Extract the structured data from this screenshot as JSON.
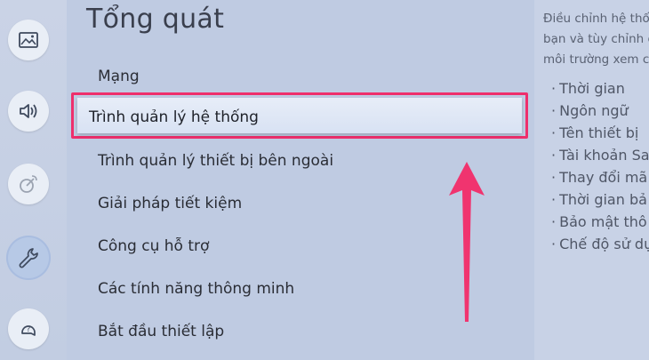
{
  "sidebar": {
    "items": [
      {
        "icon": "picture-icon"
      },
      {
        "icon": "sound-icon"
      },
      {
        "icon": "broadcast-icon"
      },
      {
        "icon": "wrench-icon"
      },
      {
        "icon": "support-icon"
      }
    ]
  },
  "menu": {
    "title": "Tổng quát",
    "items": [
      "Mạng",
      "Trình quản lý hệ thống",
      "Trình quản lý thiết bị bên ngoài",
      "Giải pháp tiết kiệm",
      "Công cụ hỗ trợ",
      "Các tính năng thông minh",
      "Bắt đầu thiết lập"
    ],
    "focused_index": 1
  },
  "description": {
    "lines": [
      "Điều chỉnh hệ thống",
      "bạn và tùy chỉnh cài",
      "môi trường xem của"
    ],
    "bullets": [
      "Thời gian",
      "Ngôn ngữ",
      "Tên thiết bị",
      "Tài khoản Sa",
      "Thay đổi mã",
      "Thời gian bả",
      "Bảo mật thô",
      "Chế độ sử dụ"
    ]
  },
  "colors": {
    "highlight_border": "#ee2f6c",
    "arrow": "#f0346f"
  }
}
